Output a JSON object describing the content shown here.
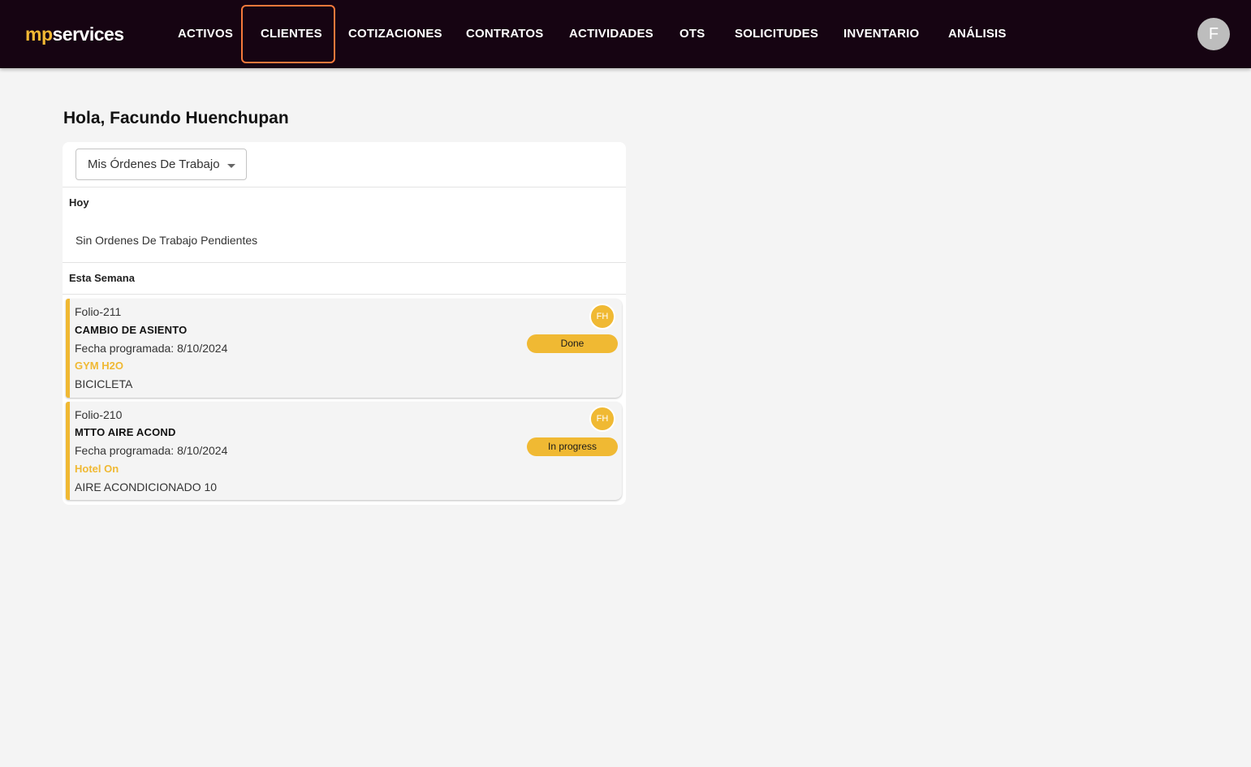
{
  "brand": {
    "logo_mp": "mp",
    "logo_services": "services",
    "accent_color": "#f0b933",
    "nav_bg": "#160412"
  },
  "nav": {
    "items": [
      "ACTIVOS",
      "CLIENTES",
      "COTIZACIONES",
      "CONTRATOS",
      "ACTIVIDADES",
      "OTS",
      "SOLICITUDES",
      "INVENTARIO",
      "ANÁLISIS"
    ],
    "highlighted": "CLIENTES",
    "user_initial": "F"
  },
  "main": {
    "greeting": "Hola, Facundo Huenchupan",
    "filter": {
      "selected": "Mis Órdenes De Trabajo",
      "icon": "caret-down-icon"
    },
    "sections": {
      "today": {
        "label": "Hoy",
        "empty_message": "Sin Ordenes De Trabajo Pendientes"
      },
      "week": {
        "label": "Esta Semana"
      }
    },
    "work_orders": [
      {
        "folio": "Folio-211",
        "title": "CAMBIO DE ASIENTO",
        "scheduled": "Fecha programada: 8/10/2024",
        "client": "GYM H2O",
        "asset": "BICICLETA",
        "assignee_initials": "FH",
        "status": "Done"
      },
      {
        "folio": "Folio-210",
        "title": "MTTO AIRE ACOND",
        "scheduled": "Fecha programada: 8/10/2024",
        "client": "Hotel On",
        "asset": "AIRE ACONDICIONADO 10",
        "assignee_initials": "FH",
        "status": "In progress"
      }
    ]
  }
}
